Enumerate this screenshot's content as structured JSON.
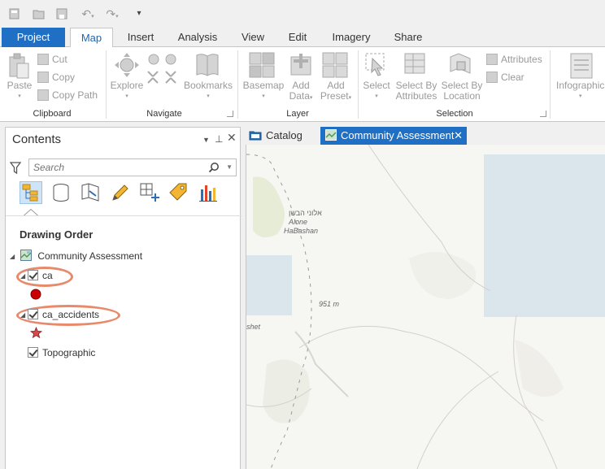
{
  "qat": {
    "icons": [
      "new-project-icon",
      "open-project-icon",
      "save-project-icon",
      "undo-icon",
      "redo-icon",
      "customize-icon"
    ]
  },
  "tabs": [
    {
      "label": "Project"
    },
    {
      "label": "Map"
    },
    {
      "label": "Insert"
    },
    {
      "label": "Analysis"
    },
    {
      "label": "View"
    },
    {
      "label": "Edit"
    },
    {
      "label": "Imagery"
    },
    {
      "label": "Share"
    }
  ],
  "ribbon": {
    "clipboard": {
      "label": "Clipboard",
      "paste": "Paste",
      "cut": "Cut",
      "copy": "Copy",
      "copy_path": "Copy Path"
    },
    "navigate": {
      "label": "Navigate",
      "explore": "Explore",
      "bookmarks": "Bookmarks"
    },
    "layer": {
      "label": "Layer",
      "basemap": "Basemap",
      "add_data_1": "Add",
      "add_data_2": "Data",
      "add_preset_1": "Add",
      "add_preset_2": "Preset"
    },
    "selection": {
      "label": "Selection",
      "select": "Select",
      "select_by_attributes_1": "Select By",
      "select_by_attributes_2": "Attributes",
      "select_by_location_1": "Select By",
      "select_by_location_2": "Location",
      "attributes": "Attributes",
      "clear": "Clear"
    },
    "infographics": "Infographic"
  },
  "contents": {
    "title": "Contents",
    "search_placeholder": "Search",
    "drawing_order": "Drawing Order",
    "map_name": "Community Assessment",
    "layers": [
      {
        "name": "ca",
        "symbol": "circle",
        "color": "#cc0000",
        "highlighted": true
      },
      {
        "name": "ca_accidents",
        "symbol": "star",
        "color": "#d94a4a",
        "highlighted": true
      },
      {
        "name": "Topographic",
        "symbol": "none",
        "highlighted": false
      }
    ]
  },
  "view_tabs": [
    {
      "label": "Catalog"
    },
    {
      "label": "Community Assessment"
    }
  ],
  "map": {
    "labels": {
      "hebrew": "אלוני הבשן",
      "alone": "Alone",
      "habashan": "HaBashan",
      "elevation": "951 m",
      "shet": "shet"
    },
    "accent": "#1f6fc4"
  }
}
